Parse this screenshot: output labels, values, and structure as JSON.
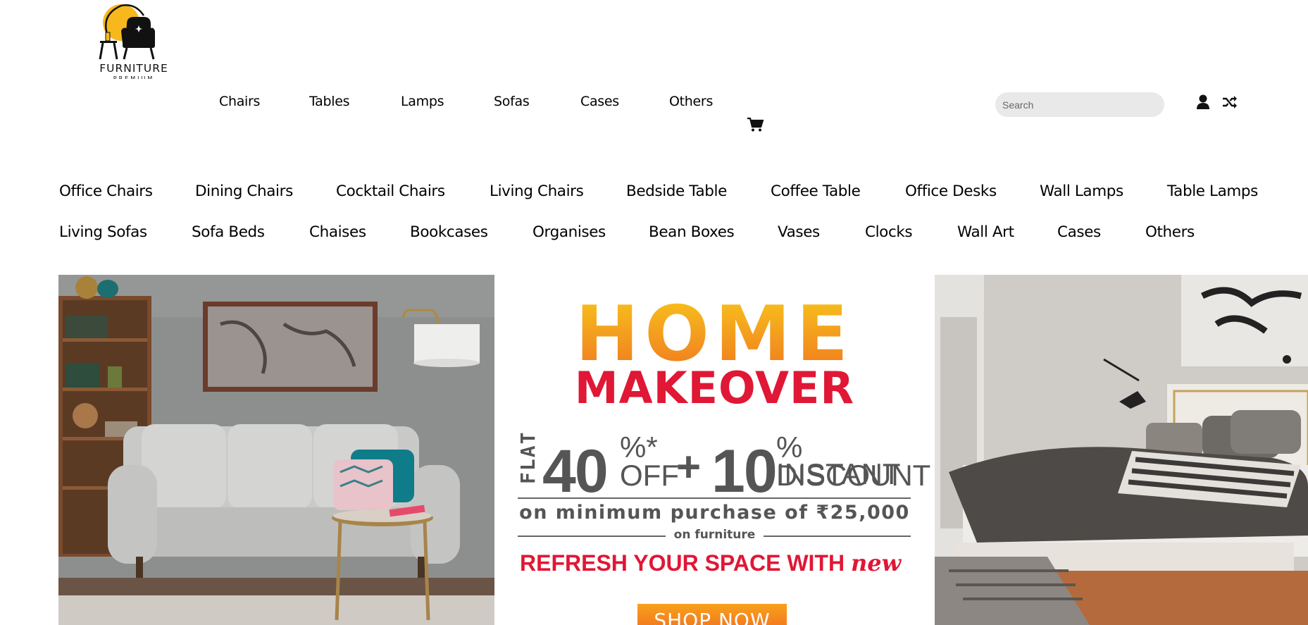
{
  "brand": {
    "logo_text": "FURNITURE",
    "logo_subtext": "PREMIUM"
  },
  "main_nav": [
    "Chairs",
    "Tables",
    "Lamps",
    "Sofas",
    "Cases",
    "Others"
  ],
  "search": {
    "placeholder": "Search"
  },
  "icons": {
    "cart": "cart-icon",
    "user": "user-icon",
    "shuffle": "shuffle-icon"
  },
  "categories": {
    "row1": [
      "Office Chairs",
      "Dining Chairs",
      "Cocktail Chairs",
      "Living Chairs",
      "Bedside Table",
      "Coffee Table",
      "Office Desks",
      "Wall Lamps",
      "Table Lamps"
    ],
    "row2": [
      "Living Sofas",
      "Sofa Beds",
      "Chaises",
      "Bookcases",
      "Organises",
      "Bean Boxes",
      "Vases",
      "Clocks",
      "Wall Art",
      "Cases",
      "Others"
    ]
  },
  "promo": {
    "headline": "HOME",
    "subheadline": "MAKEOVER",
    "flat": "FLAT",
    "discount_value": "40",
    "percent_symbol": "%*",
    "off": "OFF",
    "plus": "+",
    "instant_value": "10",
    "instant_label": "% INSTANT",
    "discount_label": "DISCOUNT",
    "minimum": "on minimum purchase of ₹25,000",
    "on_furniture": "on furniture",
    "refresh": "REFRESH YOUR SPACE WITH",
    "refresh_new": "new",
    "shop_now": "SHOP NOW"
  },
  "colors": {
    "promo_red": "#e01735",
    "promo_orange": "#f39a1f",
    "promo_gray": "#555555"
  }
}
